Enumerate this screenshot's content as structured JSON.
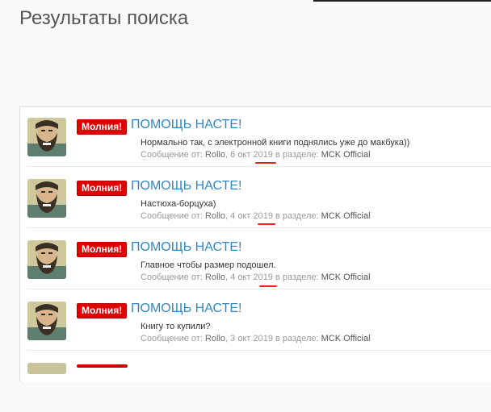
{
  "page": {
    "title": "Результаты поиска"
  },
  "results": [
    {
      "badge": "Молния!",
      "title": "ПОМОЩЬ НАСТЕ!",
      "snippet": "Нормально так, с электронной книги поднялись уже до макбука))",
      "meta_prefix": "Сообщение от: ",
      "author": "Rollo",
      "date": ", 6 окт 2019",
      "meta_mid": " в разделе: ",
      "forum": "MCK Official"
    },
    {
      "badge": "Молния!",
      "title": "ПОМОЩЬ НАСТЕ!",
      "snippet": "Настюха-борцуха)",
      "meta_prefix": "Сообщение от: ",
      "author": "Rollo",
      "date": ", 4 окт 2019",
      "meta_mid": " в разделе: ",
      "forum": "MCK Official"
    },
    {
      "badge": "Молния!",
      "title": "ПОМОЩЬ НАСТЕ!",
      "snippet": "Главное чтобы размер подошел.",
      "meta_prefix": "Сообщение от: ",
      "author": "Rollo",
      "date": ", 4 окт 2019",
      "meta_mid": " в разделе: ",
      "forum": "MCK Official"
    },
    {
      "badge": "Молния!",
      "title": "ПОМОЩЬ НАСТЕ!",
      "snippet": "Книгу то купили?",
      "meta_prefix": "Сообщение от: ",
      "author": "Rollo",
      "date": ", 3 окт 2019",
      "meta_mid": " в разделе: ",
      "forum": "MCK Official"
    }
  ],
  "colors": {
    "badge": "#e00000",
    "link": "#2f88c7",
    "annotation": "#e8201c"
  },
  "icons": {
    "avatar": "bearded-man-avatar"
  }
}
